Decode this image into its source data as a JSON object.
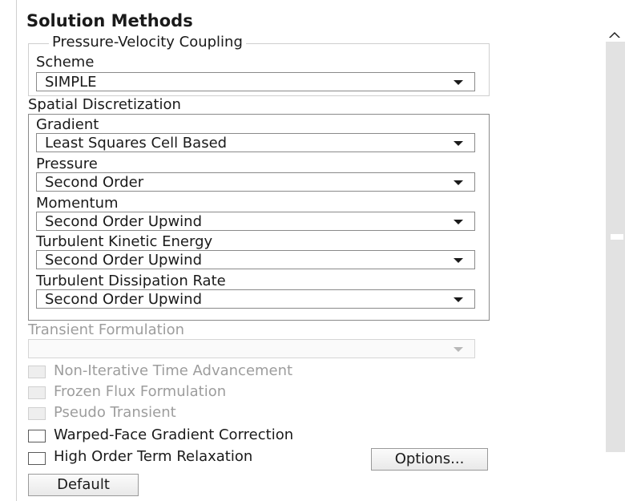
{
  "title": "Solution Methods",
  "pv_coupling": {
    "legend": "Pressure-Velocity Coupling",
    "scheme_label": "Scheme",
    "scheme_value": "SIMPLE"
  },
  "spatial": {
    "legend": "Spatial Discretization",
    "gradient_label": "Gradient",
    "gradient_value": "Least Squares Cell Based",
    "pressure_label": "Pressure",
    "pressure_value": "Second Order",
    "momentum_label": "Momentum",
    "momentum_value": "Second Order Upwind",
    "tke_label": "Turbulent Kinetic Energy",
    "tke_value": "Second Order Upwind",
    "tdr_label": "Turbulent Dissipation Rate",
    "tdr_value": "Second Order Upwind"
  },
  "transient": {
    "label": "Transient Formulation",
    "value": ""
  },
  "options": {
    "non_iterative": "Non-Iterative Time Advancement",
    "frozen_flux": "Frozen Flux Formulation",
    "pseudo_transient": "Pseudo Transient",
    "warped_face": "Warped-Face Gradient Correction",
    "high_order": "High Order Term Relaxation"
  },
  "buttons": {
    "options": "Options...",
    "default": "Default"
  }
}
